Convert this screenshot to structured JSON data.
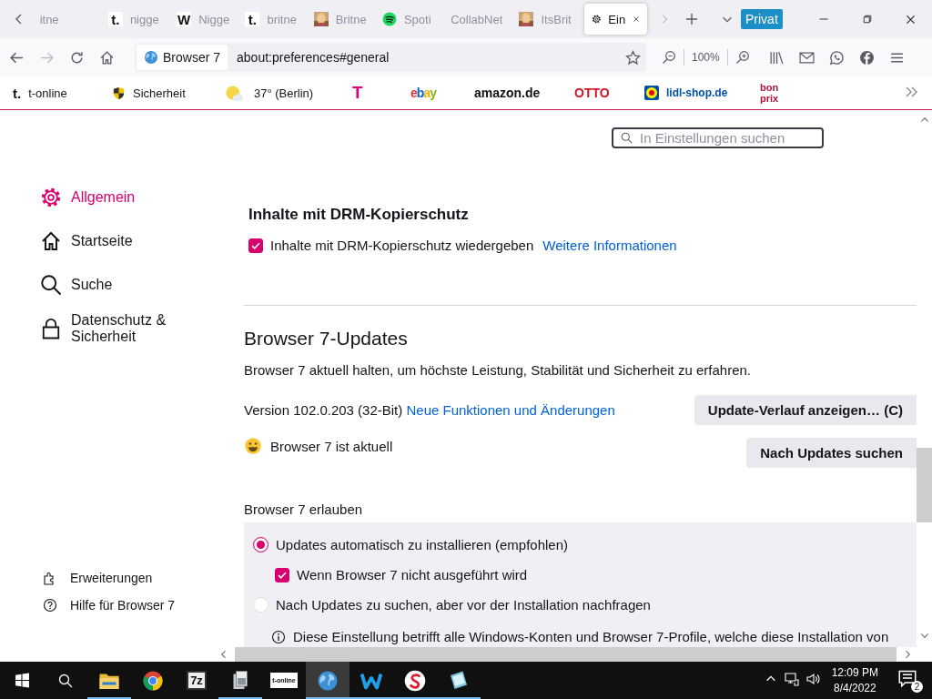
{
  "tab_bar": {
    "tabs": [
      {
        "label": "itne",
        "selected": false
      },
      {
        "label": "nigge",
        "icon_text": "t.",
        "selected": false
      },
      {
        "label": "Nigge",
        "icon_text": "W",
        "selected": false
      },
      {
        "label": "britne",
        "icon_text": "t.",
        "selected": false
      },
      {
        "label": "Britne",
        "selected": false
      },
      {
        "label": "Spoti",
        "selected": false
      },
      {
        "label": "CollabNet",
        "selected": false
      },
      {
        "label": "ItsBrit",
        "selected": false
      },
      {
        "label": "Ein",
        "selected": true
      }
    ],
    "private_badge": "Privat"
  },
  "nav_bar": {
    "identity": "Browser 7",
    "url": "about:preferences#general",
    "zoom": "100%"
  },
  "bookmarks": [
    {
      "label": "t-online",
      "kind": "site",
      "icon_text": "t."
    },
    {
      "label": "Sicherheit",
      "kind": "shield"
    },
    {
      "label": "37° (Berlin)",
      "kind": "weather"
    },
    {
      "label": "T",
      "kind": "logo",
      "color": "#e20074"
    },
    {
      "label": "ebay",
      "kind": "ebay"
    },
    {
      "label": "amazon.de",
      "kind": "logo",
      "color": "#111111"
    },
    {
      "label": "OTTO",
      "kind": "logo",
      "color": "#d4121f"
    },
    {
      "label": "lidl-shop.de",
      "kind": "lidl"
    },
    {
      "label": "bon prix",
      "kind": "logo",
      "color": "#b3123a"
    }
  ],
  "sidebar": {
    "items": [
      {
        "label": "Allgemein",
        "selected": true
      },
      {
        "label": "Startseite",
        "selected": false
      },
      {
        "label": "Suche",
        "selected": false
      },
      {
        "label": "Datenschutz & Sicherheit",
        "selected": false
      }
    ],
    "footer": [
      {
        "label": "Erweiterungen"
      },
      {
        "label": "Hilfe für Browser 7"
      }
    ]
  },
  "search": {
    "placeholder": "In Einstellungen suchen"
  },
  "drm": {
    "heading": "Inhalte mit DRM-Kopierschutz",
    "checkbox": {
      "label": "Inhalte mit DRM-Kopierschutz wiedergeben",
      "checked": true
    },
    "link": "Weitere Informationen"
  },
  "updates": {
    "heading": "Browser 7-Updates",
    "description": "Browser 7 aktuell halten, um höchste Leistung, Stabilität und Sicherheit zu erfahren.",
    "version": "Version 102.0.203 (32-Bit)",
    "version_link": "Neue Funktionen und Änderungen",
    "history_button": "Update-Verlauf anzeigen… (C)",
    "status": "Browser 7 ist aktuell",
    "check_button": "Nach Updates suchen",
    "allow_label": "Browser 7 erlauben",
    "options": [
      {
        "kind": "radio",
        "label": "Updates automatisch zu installieren (empfohlen)",
        "selected": true,
        "children": [
          {
            "kind": "checkbox",
            "label": "Wenn Browser 7 nicht ausgeführt wird",
            "checked": true
          }
        ]
      },
      {
        "kind": "radio",
        "label": "Nach Updates zu suchen, aber vor der Installation nachfragen",
        "selected": false
      }
    ],
    "note": "Diese Einstellung betrifft alle Windows-Konten und Browser 7-Profile, welche diese Installation von"
  },
  "taskbar": {
    "apps": [
      {
        "running": true,
        "selected": false
      },
      {
        "running": false,
        "selected": false
      },
      {
        "text": "7z",
        "running": false,
        "selected": false
      },
      {
        "running": true,
        "selected": false
      },
      {
        "text": "t-online",
        "running": false,
        "selected": false
      },
      {
        "running": true,
        "selected": true
      },
      {
        "running": true,
        "selected": false
      },
      {
        "running": true,
        "selected": false
      },
      {
        "running": true,
        "selected": false
      }
    ],
    "time": "12:09 PM",
    "date": "8/4/2022",
    "notifications": "2"
  }
}
